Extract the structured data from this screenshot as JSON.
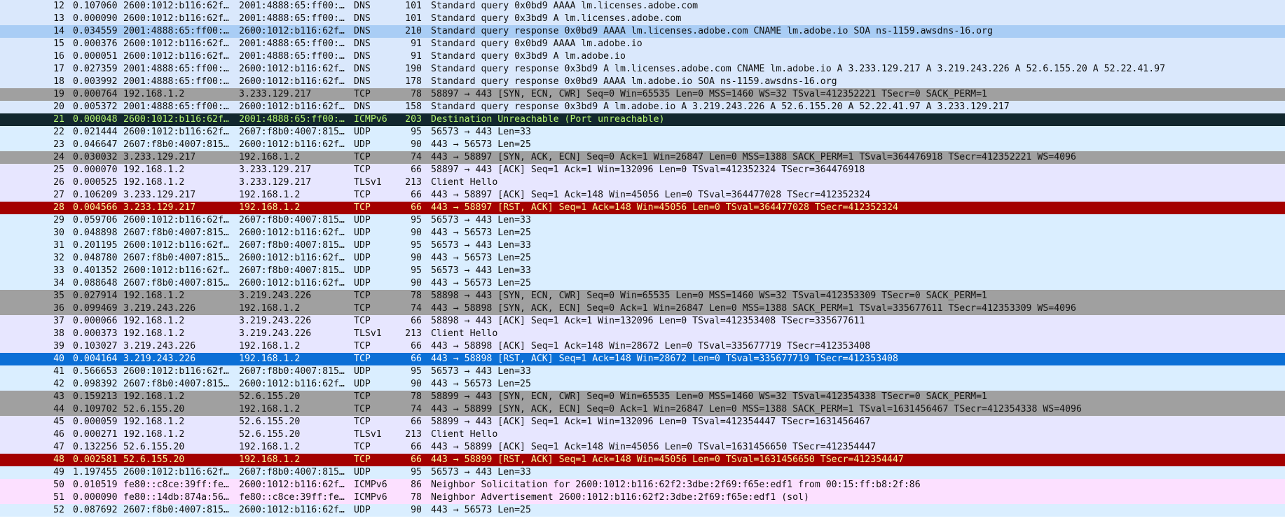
{
  "packets": [
    {
      "no": "12",
      "time": "0.107060",
      "src": "2600:1012:b116:62f…",
      "dst": "2001:4888:65:ff00:…",
      "proto": "DNS",
      "len": "101",
      "info": "Standard query 0x0bd9 AAAA lm.licenses.adobe.com",
      "style": "dns"
    },
    {
      "no": "13",
      "time": "0.000090",
      "src": "2600:1012:b116:62f…",
      "dst": "2001:4888:65:ff00:…",
      "proto": "DNS",
      "len": "101",
      "info": "Standard query 0x3bd9 A lm.licenses.adobe.com",
      "style": "dns"
    },
    {
      "no": "14",
      "time": "0.034559",
      "src": "2001:4888:65:ff00:…",
      "dst": "2600:1012:b116:62f…",
      "proto": "DNS",
      "len": "210",
      "info": "Standard query response 0x0bd9 AAAA lm.licenses.adobe.com CNAME lm.adobe.io SOA ns-1159.awsdns-16.org",
      "style": "dnsh"
    },
    {
      "no": "15",
      "time": "0.000376",
      "src": "2600:1012:b116:62f…",
      "dst": "2001:4888:65:ff00:…",
      "proto": "DNS",
      "len": "91",
      "info": "Standard query 0x0bd9 AAAA lm.adobe.io",
      "style": "dns"
    },
    {
      "no": "16",
      "time": "0.000051",
      "src": "2600:1012:b116:62f…",
      "dst": "2001:4888:65:ff00:…",
      "proto": "DNS",
      "len": "91",
      "info": "Standard query 0x3bd9 A lm.adobe.io",
      "style": "dns"
    },
    {
      "no": "17",
      "time": "0.027359",
      "src": "2001:4888:65:ff00:…",
      "dst": "2600:1012:b116:62f…",
      "proto": "DNS",
      "len": "190",
      "info": "Standard query response 0x3bd9 A lm.licenses.adobe.com CNAME lm.adobe.io A 3.233.129.217 A 3.219.243.226 A 52.6.155.20 A 52.22.41.97",
      "style": "dns"
    },
    {
      "no": "18",
      "time": "0.003992",
      "src": "2001:4888:65:ff00:…",
      "dst": "2600:1012:b116:62f…",
      "proto": "DNS",
      "len": "178",
      "info": "Standard query response 0x0bd9 AAAA lm.adobe.io SOA ns-1159.awsdns-16.org",
      "style": "dns"
    },
    {
      "no": "19",
      "time": "0.000764",
      "src": "192.168.1.2",
      "dst": "3.233.129.217",
      "proto": "TCP",
      "len": "78",
      "info": "58897 → 443 [SYN, ECN, CWR] Seq=0 Win=65535 Len=0 MSS=1460 WS=32 TSval=412352221 TSecr=0 SACK_PERM=1",
      "style": "syn"
    },
    {
      "no": "20",
      "time": "0.005372",
      "src": "2001:4888:65:ff00:…",
      "dst": "2600:1012:b116:62f…",
      "proto": "DNS",
      "len": "158",
      "info": "Standard query response 0x3bd9 A lm.adobe.io A 3.219.243.226 A 52.6.155.20 A 52.22.41.97 A 3.233.129.217",
      "style": "dns"
    },
    {
      "no": "21",
      "time": "0.000048",
      "src": "2600:1012:b116:62f…",
      "dst": "2001:4888:65:ff00:…",
      "proto": "ICMPv6",
      "len": "203",
      "info": "Destination Unreachable (Port unreachable)",
      "style": "icmpe"
    },
    {
      "no": "22",
      "time": "0.021444",
      "src": "2600:1012:b116:62f…",
      "dst": "2607:f8b0:4007:815…",
      "proto": "UDP",
      "len": "95",
      "info": "56573 → 443 Len=33",
      "style": "udp"
    },
    {
      "no": "23",
      "time": "0.046647",
      "src": "2607:f8b0:4007:815…",
      "dst": "2600:1012:b116:62f…",
      "proto": "UDP",
      "len": "90",
      "info": "443 → 56573 Len=25",
      "style": "udp"
    },
    {
      "no": "24",
      "time": "0.030032",
      "src": "3.233.129.217",
      "dst": "192.168.1.2",
      "proto": "TCP",
      "len": "74",
      "info": "443 → 58897 [SYN, ACK, ECN] Seq=0 Ack=1 Win=26847 Len=0 MSS=1388 SACK_PERM=1 TSval=364476918 TSecr=412352221 WS=4096",
      "style": "syn"
    },
    {
      "no": "25",
      "time": "0.000070",
      "src": "192.168.1.2",
      "dst": "3.233.129.217",
      "proto": "TCP",
      "len": "66",
      "info": "58897 → 443 [ACK] Seq=1 Ack=1 Win=132096 Len=0 TSval=412352324 TSecr=364476918",
      "style": "tcp"
    },
    {
      "no": "26",
      "time": "0.000525",
      "src": "192.168.1.2",
      "dst": "3.233.129.217",
      "proto": "TLSv1",
      "len": "213",
      "info": "Client Hello",
      "style": "tls"
    },
    {
      "no": "27",
      "time": "0.106209",
      "src": "3.233.129.217",
      "dst": "192.168.1.2",
      "proto": "TCP",
      "len": "66",
      "info": "443 → 58897 [ACK] Seq=1 Ack=148 Win=45056 Len=0 TSval=364477028 TSecr=412352324",
      "style": "tcp"
    },
    {
      "no": "28",
      "time": "0.004566",
      "src": "3.233.129.217",
      "dst": "192.168.1.2",
      "proto": "TCP",
      "len": "66",
      "info": "443 → 58897 [RST, ACK] Seq=1 Ack=148 Win=45056 Len=0 TSval=364477028 TSecr=412352324",
      "style": "rst"
    },
    {
      "no": "29",
      "time": "0.059706",
      "src": "2600:1012:b116:62f…",
      "dst": "2607:f8b0:4007:815…",
      "proto": "UDP",
      "len": "95",
      "info": "56573 → 443 Len=33",
      "style": "udp"
    },
    {
      "no": "30",
      "time": "0.048898",
      "src": "2607:f8b0:4007:815…",
      "dst": "2600:1012:b116:62f…",
      "proto": "UDP",
      "len": "90",
      "info": "443 → 56573 Len=25",
      "style": "udp"
    },
    {
      "no": "31",
      "time": "0.201195",
      "src": "2600:1012:b116:62f…",
      "dst": "2607:f8b0:4007:815…",
      "proto": "UDP",
      "len": "95",
      "info": "56573 → 443 Len=33",
      "style": "udp"
    },
    {
      "no": "32",
      "time": "0.048780",
      "src": "2607:f8b0:4007:815…",
      "dst": "2600:1012:b116:62f…",
      "proto": "UDP",
      "len": "90",
      "info": "443 → 56573 Len=25",
      "style": "udp"
    },
    {
      "no": "33",
      "time": "0.401352",
      "src": "2600:1012:b116:62f…",
      "dst": "2607:f8b0:4007:815…",
      "proto": "UDP",
      "len": "95",
      "info": "56573 → 443 Len=33",
      "style": "udp"
    },
    {
      "no": "34",
      "time": "0.088648",
      "src": "2607:f8b0:4007:815…",
      "dst": "2600:1012:b116:62f…",
      "proto": "UDP",
      "len": "90",
      "info": "443 → 56573 Len=25",
      "style": "udp"
    },
    {
      "no": "35",
      "time": "0.027914",
      "src": "192.168.1.2",
      "dst": "3.219.243.226",
      "proto": "TCP",
      "len": "78",
      "info": "58898 → 443 [SYN, ECN, CWR] Seq=0 Win=65535 Len=0 MSS=1460 WS=32 TSval=412353309 TSecr=0 SACK_PERM=1",
      "style": "syn"
    },
    {
      "no": "36",
      "time": "0.099469",
      "src": "3.219.243.226",
      "dst": "192.168.1.2",
      "proto": "TCP",
      "len": "74",
      "info": "443 → 58898 [SYN, ACK, ECN] Seq=0 Ack=1 Win=26847 Len=0 MSS=1388 SACK_PERM=1 TSval=335677611 TSecr=412353309 WS=4096",
      "style": "syn"
    },
    {
      "no": "37",
      "time": "0.000066",
      "src": "192.168.1.2",
      "dst": "3.219.243.226",
      "proto": "TCP",
      "len": "66",
      "info": "58898 → 443 [ACK] Seq=1 Ack=1 Win=132096 Len=0 TSval=412353408 TSecr=335677611",
      "style": "tcp"
    },
    {
      "no": "38",
      "time": "0.000373",
      "src": "192.168.1.2",
      "dst": "3.219.243.226",
      "proto": "TLSv1",
      "len": "213",
      "info": "Client Hello",
      "style": "tls"
    },
    {
      "no": "39",
      "time": "0.103027",
      "src": "3.219.243.226",
      "dst": "192.168.1.2",
      "proto": "TCP",
      "len": "66",
      "info": "443 → 58898 [ACK] Seq=1 Ack=148 Win=28672 Len=0 TSval=335677719 TSecr=412353408",
      "style": "tcp"
    },
    {
      "no": "40",
      "time": "0.004164",
      "src": "3.219.243.226",
      "dst": "192.168.1.2",
      "proto": "TCP",
      "len": "66",
      "info": "443 → 58898 [RST, ACK] Seq=1 Ack=148 Win=28672 Len=0 TSval=335677719 TSecr=412353408",
      "style": "sel"
    },
    {
      "no": "41",
      "time": "0.566653",
      "src": "2600:1012:b116:62f…",
      "dst": "2607:f8b0:4007:815…",
      "proto": "UDP",
      "len": "95",
      "info": "56573 → 443 Len=33",
      "style": "udp"
    },
    {
      "no": "42",
      "time": "0.098392",
      "src": "2607:f8b0:4007:815…",
      "dst": "2600:1012:b116:62f…",
      "proto": "UDP",
      "len": "90",
      "info": "443 → 56573 Len=25",
      "style": "udp"
    },
    {
      "no": "43",
      "time": "0.159213",
      "src": "192.168.1.2",
      "dst": "52.6.155.20",
      "proto": "TCP",
      "len": "78",
      "info": "58899 → 443 [SYN, ECN, CWR] Seq=0 Win=65535 Len=0 MSS=1460 WS=32 TSval=412354338 TSecr=0 SACK_PERM=1",
      "style": "syn"
    },
    {
      "no": "44",
      "time": "0.109702",
      "src": "52.6.155.20",
      "dst": "192.168.1.2",
      "proto": "TCP",
      "len": "74",
      "info": "443 → 58899 [SYN, ACK, ECN] Seq=0 Ack=1 Win=26847 Len=0 MSS=1388 SACK_PERM=1 TSval=1631456467 TSecr=412354338 WS=4096",
      "style": "syn"
    },
    {
      "no": "45",
      "time": "0.000059",
      "src": "192.168.1.2",
      "dst": "52.6.155.20",
      "proto": "TCP",
      "len": "66",
      "info": "58899 → 443 [ACK] Seq=1 Ack=1 Win=132096 Len=0 TSval=412354447 TSecr=1631456467",
      "style": "tcp"
    },
    {
      "no": "46",
      "time": "0.000271",
      "src": "192.168.1.2",
      "dst": "52.6.155.20",
      "proto": "TLSv1",
      "len": "213",
      "info": "Client Hello",
      "style": "tls"
    },
    {
      "no": "47",
      "time": "0.132256",
      "src": "52.6.155.20",
      "dst": "192.168.1.2",
      "proto": "TCP",
      "len": "66",
      "info": "443 → 58899 [ACK] Seq=1 Ack=148 Win=45056 Len=0 TSval=1631456650 TSecr=412354447",
      "style": "tcp"
    },
    {
      "no": "48",
      "time": "0.002581",
      "src": "52.6.155.20",
      "dst": "192.168.1.2",
      "proto": "TCP",
      "len": "66",
      "info": "443 → 58899 [RST, ACK] Seq=1 Ack=148 Win=45056 Len=0 TSval=1631456650 TSecr=412354447",
      "style": "rst"
    },
    {
      "no": "49",
      "time": "1.197455",
      "src": "2600:1012:b116:62f…",
      "dst": "2607:f8b0:4007:815…",
      "proto": "UDP",
      "len": "95",
      "info": "56573 → 443 Len=33",
      "style": "udp"
    },
    {
      "no": "50",
      "time": "0.010519",
      "src": "fe80::c8ce:39ff:fe…",
      "dst": "2600:1012:b116:62f…",
      "proto": "ICMPv6",
      "len": "86",
      "info": "Neighbor Solicitation for 2600:1012:b116:62f2:3dbe:2f69:f65e:edf1 from 00:15:ff:b8:2f:86",
      "style": "icmp"
    },
    {
      "no": "51",
      "time": "0.000090",
      "src": "fe80::14db:874a:56…",
      "dst": "fe80::c8ce:39ff:fe…",
      "proto": "ICMPv6",
      "len": "78",
      "info": "Neighbor Advertisement 2600:1012:b116:62f2:3dbe:2f69:f65e:edf1 (sol)",
      "style": "icmp"
    },
    {
      "no": "52",
      "time": "0.087692",
      "src": "2607:f8b0:4007:815…",
      "dst": "2600:1012:b116:62f…",
      "proto": "UDP",
      "len": "90",
      "info": "443 → 56573 Len=25",
      "style": "udp"
    }
  ],
  "colors": {
    "dns": "#dae8fc",
    "dnsh": "#a9cdf5",
    "udp": "#daeeff",
    "syn": "#a0a0a0",
    "tcp": "#e7e6ff",
    "tls": "#e7e6ff",
    "icmpe": "#12272e",
    "rst": "#a40000",
    "sel": "#0b6fd6",
    "icmp": "#fce0ff"
  }
}
